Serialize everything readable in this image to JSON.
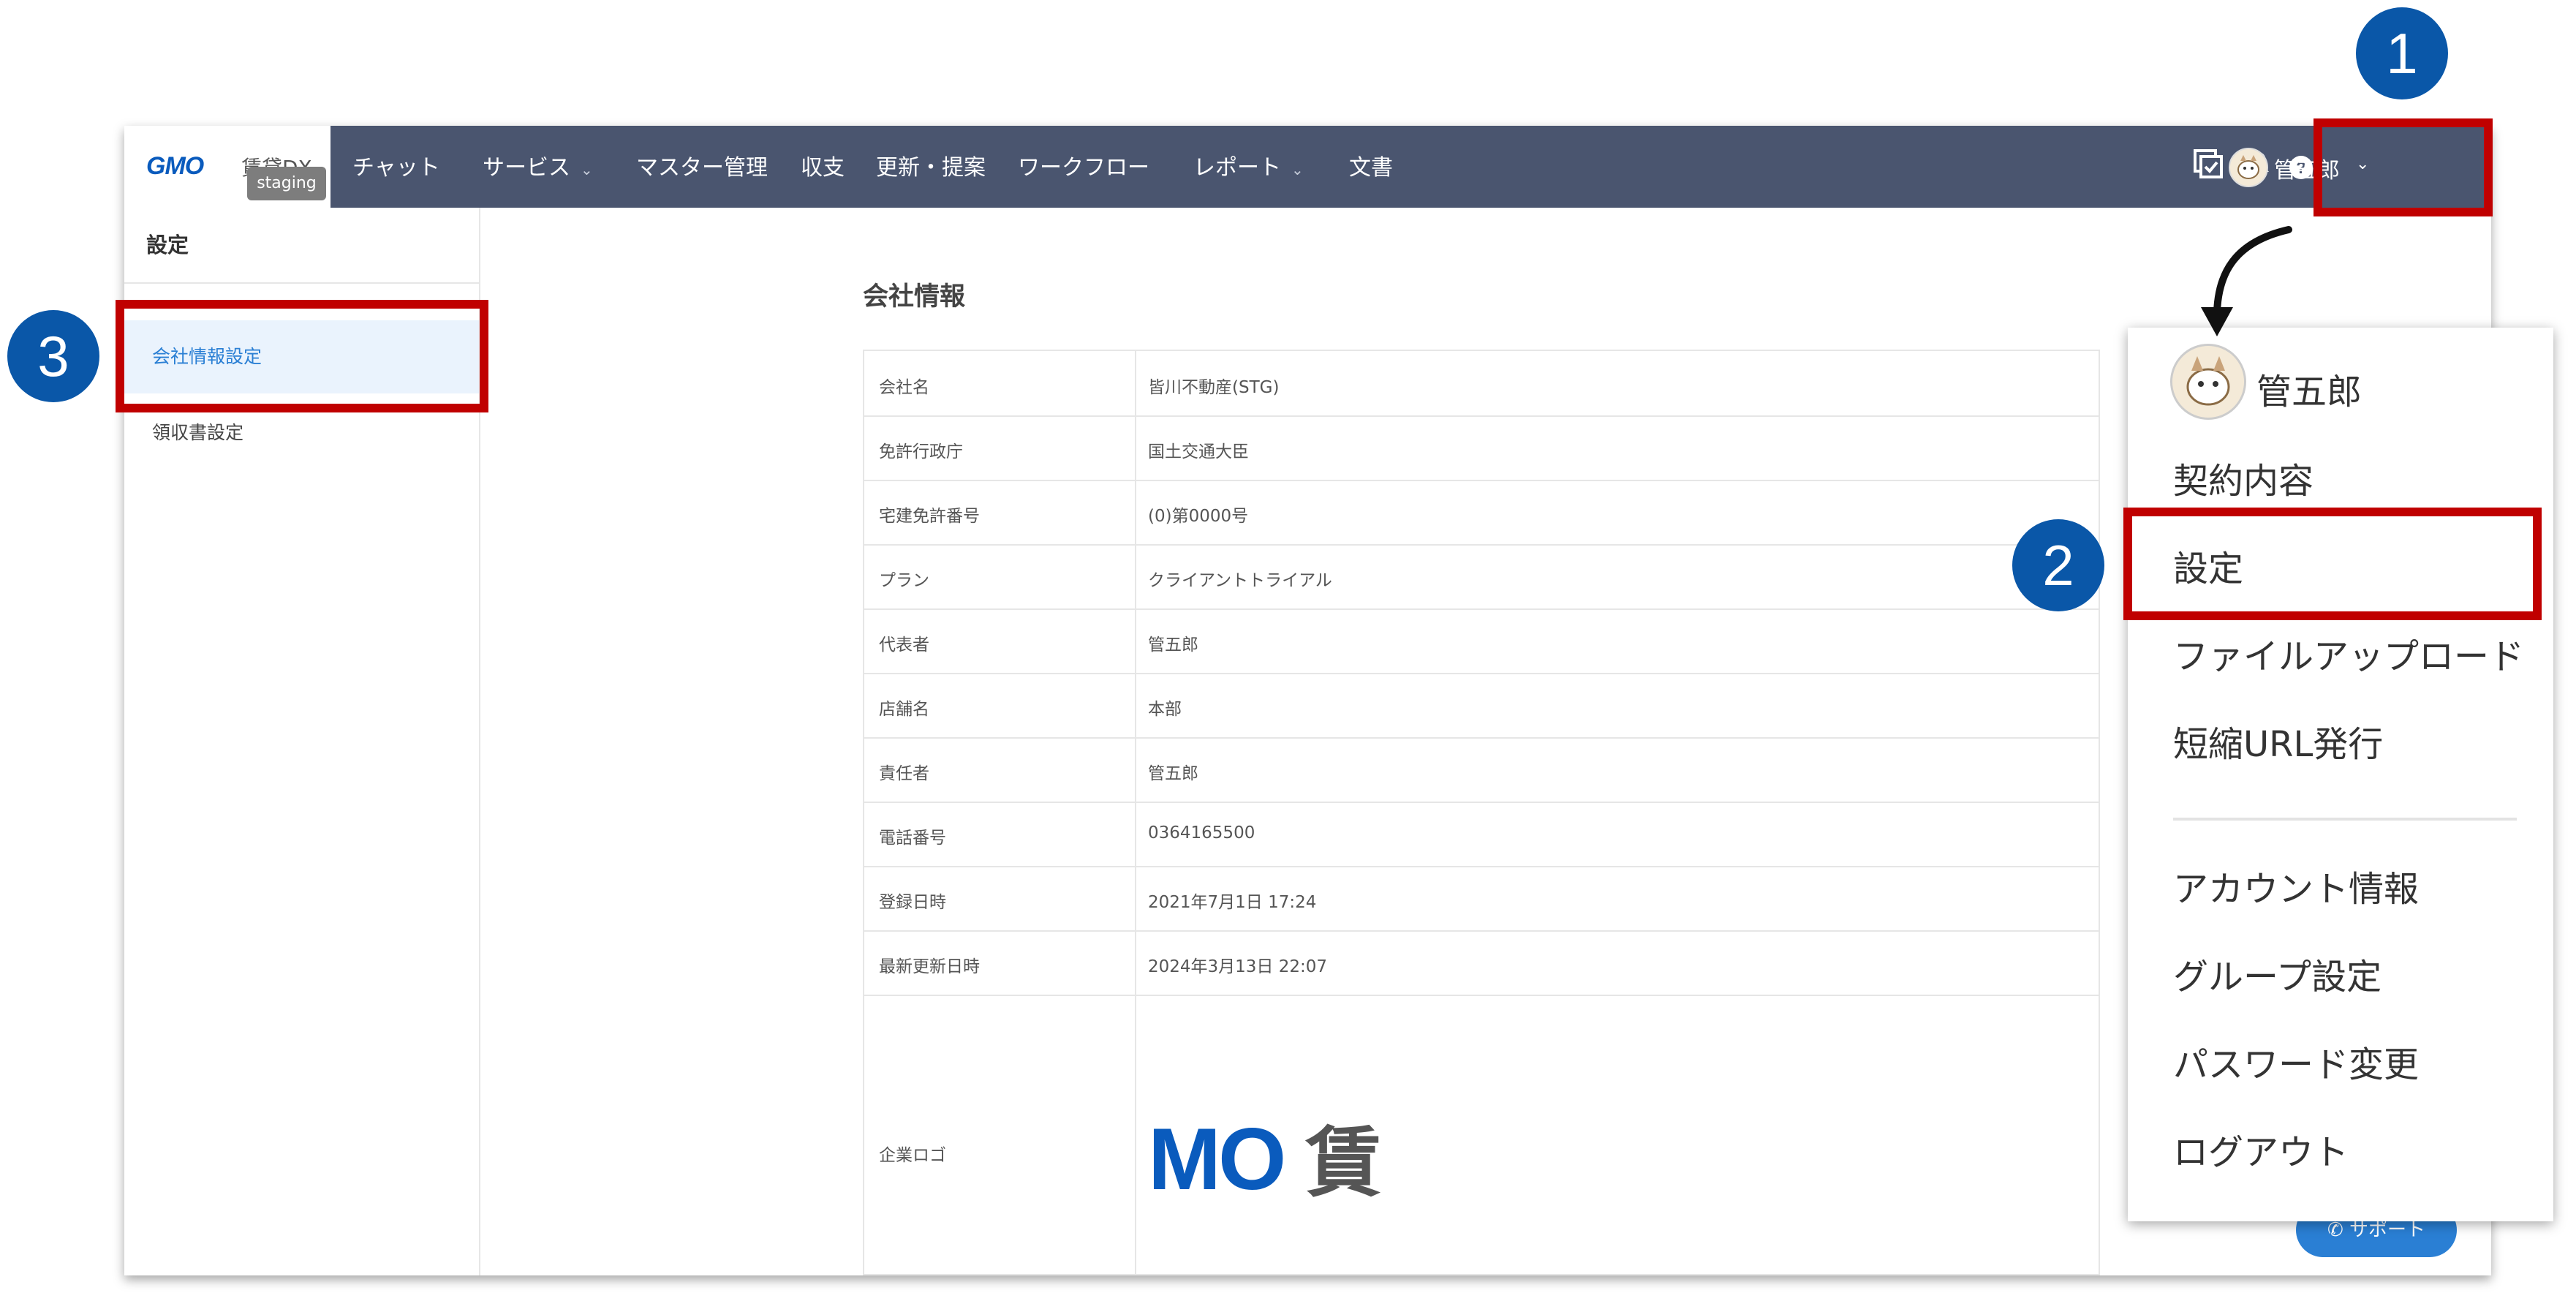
{
  "header": {
    "logo_text": "GMO",
    "logo_sub": "賃貸DX",
    "env_badge": "staging",
    "nav": [
      {
        "label": "チャット",
        "has_dropdown": false
      },
      {
        "label": "サービス",
        "has_dropdown": true
      },
      {
        "label": "マスター管理",
        "has_dropdown": false
      },
      {
        "label": "収支",
        "has_dropdown": false
      },
      {
        "label": "更新・提案",
        "has_dropdown": false
      },
      {
        "label": "ワークフロー",
        "has_dropdown": false
      },
      {
        "label": "レポート",
        "has_dropdown": true
      },
      {
        "label": "文書",
        "has_dropdown": false
      }
    ],
    "icons": [
      "task-check-icon",
      "bell-icon",
      "help-icon"
    ],
    "user_name": "管五郎"
  },
  "sidebar": {
    "title": "設定",
    "items": [
      {
        "label": "会社情報設定",
        "active": true
      },
      {
        "label": "領収書設定",
        "active": false
      }
    ]
  },
  "main": {
    "title": "会社情報",
    "rows": [
      {
        "key": "会社名",
        "value": "皆川不動産(STG)"
      },
      {
        "key": "免許行政庁",
        "value": "国土交通大臣"
      },
      {
        "key": "宅建免許番号",
        "value": "(0)第0000号"
      },
      {
        "key": "プラン",
        "value": "クライアントトライアル"
      },
      {
        "key": "代表者",
        "value": "管五郎"
      },
      {
        "key": "店舗名",
        "value": "本部"
      },
      {
        "key": "責任者",
        "value": "管五郎"
      },
      {
        "key": "電話番号",
        "value": "0364165500"
      },
      {
        "key": "登録日時",
        "value": "2021年7月1日 17:24"
      },
      {
        "key": "最新更新日時",
        "value": "2024年3月13日 22:07"
      }
    ],
    "logo_row": {
      "key": "企業ロゴ",
      "value_text": "MO",
      "value_kanji": "賃"
    },
    "support_button": "サポート"
  },
  "dropdown": {
    "user_name": "管五郎",
    "items_primary": [
      "契約内容",
      "設定",
      "ファイルアップロード",
      "短縮URL発行"
    ],
    "items_secondary": [
      "アカウント情報",
      "グループ設定",
      "パスワード変更",
      "ログアウト"
    ]
  },
  "annotations": {
    "badges": [
      "1",
      "2",
      "3"
    ],
    "color_box": "#c00000",
    "color_badge": "#0a57a8"
  },
  "colors": {
    "header_bg": "#4a556f",
    "accent": "#2a7fd4",
    "active_bg": "#eaf3fd"
  }
}
